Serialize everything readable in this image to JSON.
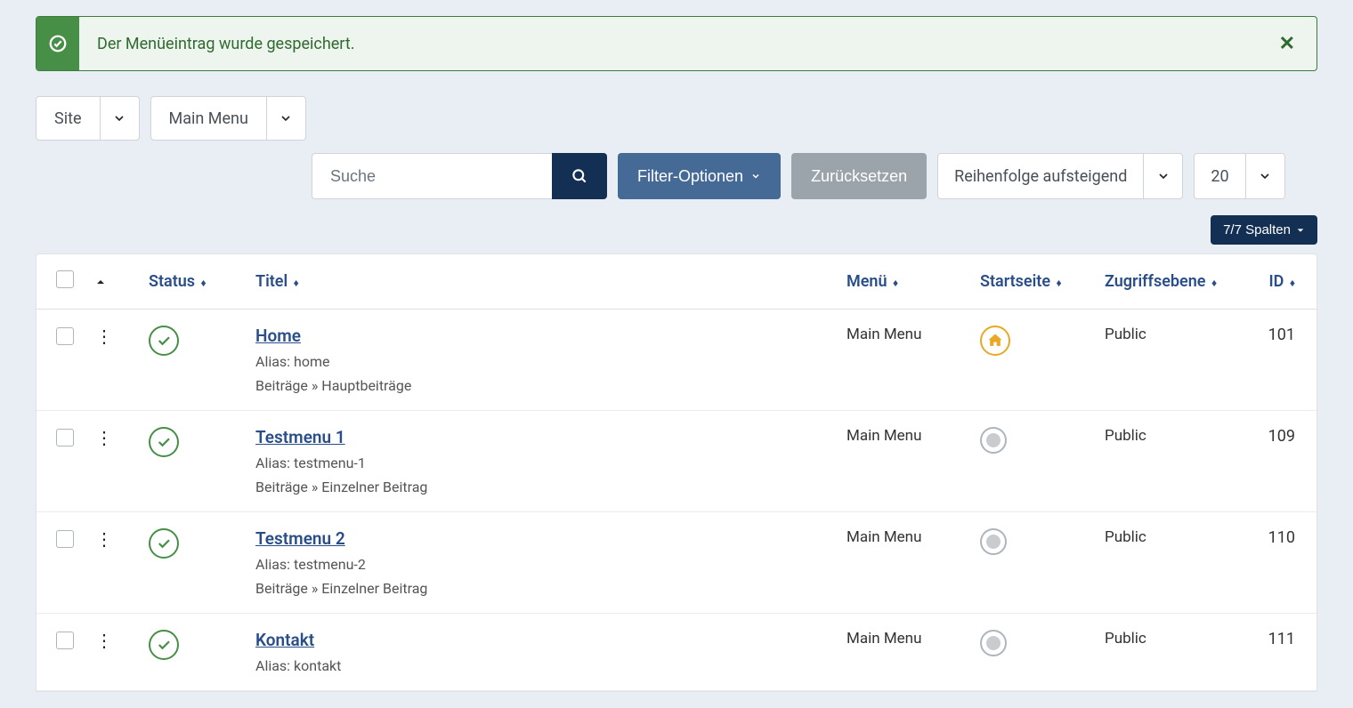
{
  "alert": {
    "message": "Der Menüeintrag wurde gespeichert."
  },
  "selectors": {
    "client": "Site",
    "menu": "Main Menu"
  },
  "search": {
    "placeholder": "Suche"
  },
  "buttons": {
    "filter_options": "Filter-Optionen",
    "reset": "Zurücksetzen",
    "sort": "Reihenfolge aufsteigend",
    "per_page": "20",
    "columns": "7/7 Spalten"
  },
  "headers": {
    "status": "Status",
    "title": "Titel",
    "menu": "Menü",
    "startpage": "Startseite",
    "access": "Zugriffsebene",
    "id": "ID"
  },
  "rows": [
    {
      "title": "Home",
      "alias": "Alias: home",
      "path": "Beiträge » Hauptbeiträge",
      "menu": "Main Menu",
      "is_home": true,
      "access": "Public",
      "id": "101"
    },
    {
      "title": "Testmenu 1",
      "alias": "Alias: testmenu-1",
      "path": "Beiträge » Einzelner Beitrag",
      "menu": "Main Menu",
      "is_home": false,
      "access": "Public",
      "id": "109"
    },
    {
      "title": "Testmenu 2",
      "alias": "Alias: testmenu-2",
      "path": "Beiträge » Einzelner Beitrag",
      "menu": "Main Menu",
      "is_home": false,
      "access": "Public",
      "id": "110"
    },
    {
      "title": "Kontakt",
      "alias": "Alias: kontakt",
      "path": "",
      "menu": "Main Menu",
      "is_home": false,
      "access": "Public",
      "id": "111"
    }
  ]
}
